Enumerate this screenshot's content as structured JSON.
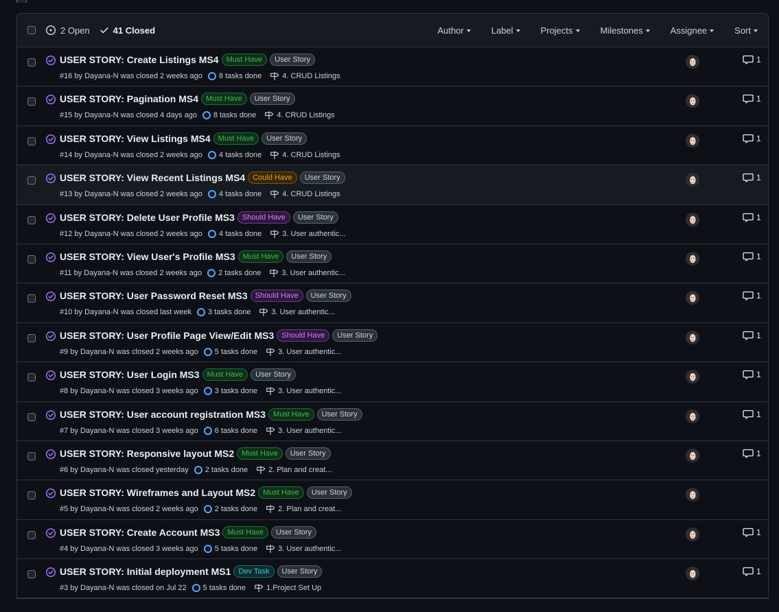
{
  "header": {
    "open_label": "2 Open",
    "closed_label": "41 Closed",
    "filters": [
      "Author",
      "Label",
      "Projects",
      "Milestones",
      "Assignee",
      "Sort"
    ]
  },
  "colors": {
    "must_have": "#3fb950",
    "could_have": "#e3a125",
    "should_have": "#d083f0",
    "dev_task": "#39c5cf",
    "user_story": "#c9d1d9",
    "closed_icon": "#a371f7"
  },
  "issues": [
    {
      "title": "USER STORY: Create Listings MS4",
      "labels": [
        {
          "text": "Must Have",
          "kind": "must"
        },
        {
          "text": "User Story",
          "kind": "story"
        }
      ],
      "meta": "#16 by Dayana-N was closed 2 weeks ago",
      "tasks": "8 tasks done",
      "milestone": "4. CRUD Listings",
      "comments": "1"
    },
    {
      "title": "USER STORY: Pagination MS4",
      "labels": [
        {
          "text": "Must Have",
          "kind": "must"
        },
        {
          "text": "User Story",
          "kind": "story"
        }
      ],
      "meta": "#15 by Dayana-N was closed 4 days ago",
      "tasks": "8 tasks done",
      "milestone": "4. CRUD Listings",
      "comments": "1"
    },
    {
      "title": "USER STORY: View Listings MS4",
      "labels": [
        {
          "text": "Must Have",
          "kind": "must"
        },
        {
          "text": "User Story",
          "kind": "story"
        }
      ],
      "meta": "#14 by Dayana-N was closed 2 weeks ago",
      "tasks": "4 tasks done",
      "milestone": "4. CRUD Listings",
      "comments": "1"
    },
    {
      "title": "USER STORY: View Recent Listings MS4",
      "labels": [
        {
          "text": "Could Have",
          "kind": "could"
        },
        {
          "text": "User Story",
          "kind": "story"
        }
      ],
      "meta": "#13 by Dayana-N was closed 2 weeks ago",
      "tasks": "4 tasks done",
      "milestone": "4. CRUD Listings",
      "comments": "1",
      "highlight": true
    },
    {
      "title": "USER STORY: Delete User Profile MS3",
      "labels": [
        {
          "text": "Should Have",
          "kind": "should"
        },
        {
          "text": "User Story",
          "kind": "story"
        }
      ],
      "meta": "#12 by Dayana-N was closed 2 weeks ago",
      "tasks": "4 tasks done",
      "milestone": "3. User authentic...",
      "comments": "1"
    },
    {
      "title": "USER STORY: View User's Profile MS3",
      "labels": [
        {
          "text": "Must Have",
          "kind": "must"
        },
        {
          "text": "User Story",
          "kind": "story"
        }
      ],
      "meta": "#11 by Dayana-N was closed 2 weeks ago",
      "tasks": "2 tasks done",
      "milestone": "3. User authentic...",
      "comments": "1"
    },
    {
      "title": "USER STORY: User Password Reset MS3",
      "labels": [
        {
          "text": "Should Have",
          "kind": "should"
        },
        {
          "text": "User Story",
          "kind": "story"
        }
      ],
      "meta": "#10 by Dayana-N was closed last week",
      "tasks": "3 tasks done",
      "milestone": "3. User authentic...",
      "comments": "1"
    },
    {
      "title": "USER STORY: User Profile Page View/Edit MS3",
      "labels": [
        {
          "text": "Should Have",
          "kind": "should"
        },
        {
          "text": "User Story",
          "kind": "story"
        }
      ],
      "meta": "#9 by Dayana-N was closed 2 weeks ago",
      "tasks": "5 tasks done",
      "milestone": "3. User authentic...",
      "comments": "1"
    },
    {
      "title": "USER STORY: User Login MS3",
      "labels": [
        {
          "text": "Must Have",
          "kind": "must"
        },
        {
          "text": "User Story",
          "kind": "story"
        }
      ],
      "meta": "#8 by Dayana-N was closed 3 weeks ago",
      "tasks": "3 tasks done",
      "milestone": "3. User authentic...",
      "comments": "1"
    },
    {
      "title": "USER STORY: User account registration MS3",
      "labels": [
        {
          "text": "Must Have",
          "kind": "must"
        },
        {
          "text": "User Story",
          "kind": "story"
        }
      ],
      "meta": "#7 by Dayana-N was closed 3 weeks ago",
      "tasks": "6 tasks done",
      "milestone": "3. User authentic...",
      "comments": "1"
    },
    {
      "title": "USER STORY: Responsive layout MS2",
      "labels": [
        {
          "text": "Must Have",
          "kind": "must"
        },
        {
          "text": "User Story",
          "kind": "story"
        }
      ],
      "meta": "#6 by Dayana-N was closed yesterday",
      "tasks": "2 tasks done",
      "milestone": "2. Plan and creat...",
      "comments": "1"
    },
    {
      "title": "USER STORY: Wireframes and Layout MS2",
      "labels": [
        {
          "text": "Must Have",
          "kind": "must"
        },
        {
          "text": "User Story",
          "kind": "story"
        }
      ],
      "meta": "#5 by Dayana-N was closed 2 weeks ago",
      "tasks": "2 tasks done",
      "milestone": "2. Plan and creat...",
      "comments": ""
    },
    {
      "title": "USER STORY: Create Account MS3",
      "labels": [
        {
          "text": "Must Have",
          "kind": "must"
        },
        {
          "text": "User Story",
          "kind": "story"
        }
      ],
      "meta": "#4 by Dayana-N was closed 3 weeks ago",
      "tasks": "5 tasks done",
      "milestone": "3. User authentic...",
      "comments": "1"
    },
    {
      "title": "USER STORY: Initial deployment MS1",
      "labels": [
        {
          "text": "Dev Task",
          "kind": "dev"
        },
        {
          "text": "User Story",
          "kind": "story"
        }
      ],
      "meta": "#3 by Dayana-N was closed on Jul 22",
      "tasks": "5 tasks done",
      "milestone": "1.Project Set Up",
      "comments": "1"
    }
  ]
}
